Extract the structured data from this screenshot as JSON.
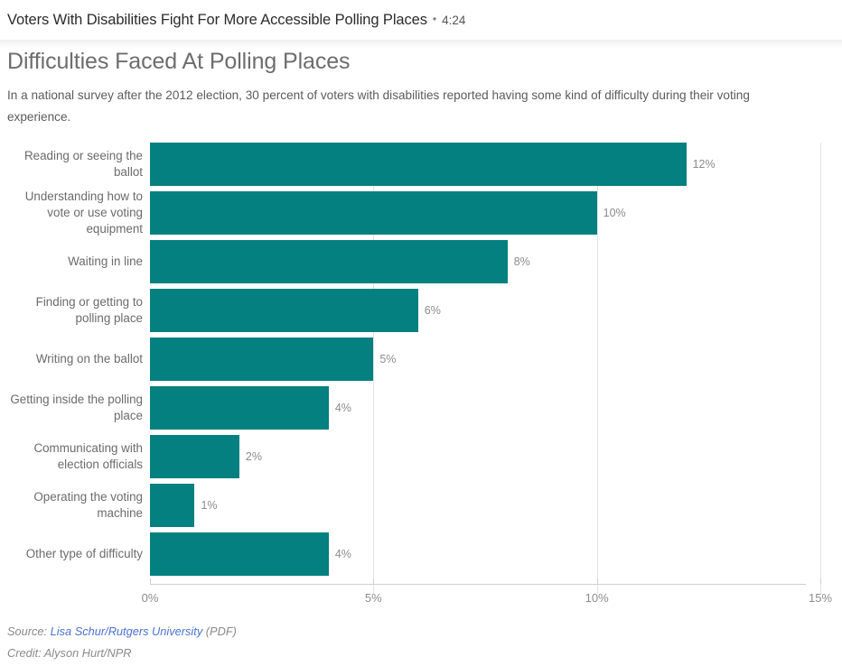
{
  "player": {
    "title": "Voters With Disabilities Fight For More Accessible Polling Places",
    "separator": "•",
    "duration": "4:24"
  },
  "chart": {
    "title": "Difficulties Faced At Polling Places",
    "subtitle": "In a national survey after the 2012 election, 30 percent of voters with disabilities reported having some kind of difficulty during their voting experience."
  },
  "footer": {
    "source_prefix": "Source:",
    "source_link": "Lisa Schur/Rutgers University",
    "source_suffix": "(PDF)",
    "credit": "Credit: Alyson Hurt/NPR"
  },
  "colors": {
    "bar": "#03807f",
    "link": "#4a73d6",
    "grid": "#e3e3e3",
    "axis": "#cfcfcf",
    "label": "#6b6b6b"
  },
  "chart_data": {
    "type": "bar",
    "orientation": "horizontal",
    "title": "Difficulties Faced At Polling Places",
    "subtitle": "In a national survey after the 2012 election, 30 percent of voters with disabilities reported having some kind of difficulty during their voting experience.",
    "xlabel": "",
    "ylabel": "",
    "xlim": [
      0,
      15
    ],
    "grid": true,
    "legend": false,
    "xticks": [
      0,
      5,
      10,
      15
    ],
    "xtick_labels": [
      "0%",
      "5%",
      "10%",
      "15%"
    ],
    "categories": [
      "Reading or seeing the ballot",
      "Understanding how to vote or use voting equipment",
      "Waiting in line",
      "Finding or getting to polling place",
      "Writing on the ballot",
      "Getting inside the polling place",
      "Communicating with election officials",
      "Operating the voting machine",
      "Other type of difficulty"
    ],
    "values": [
      12,
      10,
      8,
      6,
      5,
      4,
      2,
      1,
      4
    ],
    "value_labels": [
      "12%",
      "10%",
      "8%",
      "6%",
      "5%",
      "4%",
      "2%",
      "1%",
      "4%"
    ]
  }
}
